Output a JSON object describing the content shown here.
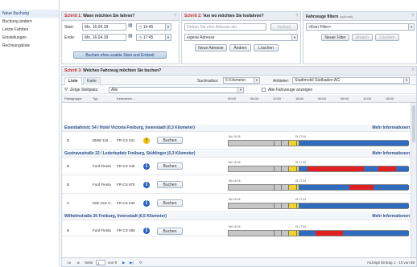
{
  "sidebar": {
    "items": [
      {
        "label": "Neue Buchung"
      },
      {
        "label": "Buchung ändern"
      },
      {
        "label": "Letzte Fahrten"
      },
      {
        "label": "Einstellungen"
      },
      {
        "label": "Rechnungsliste"
      }
    ]
  },
  "step1": {
    "step": "Schritt 1:",
    "title": "Wann möchten Sie fahren?",
    "help": "?",
    "start_label": "Start:",
    "start_date": "Mo. 16.04.18",
    "start_time": "14:45",
    "end_label": "Ende:",
    "end_date": "Mo. 16.04.18",
    "end_time": "17:45",
    "button": "Buchen ohne exakte Start und Endzeit"
  },
  "step2": {
    "step": "Schritt 2:",
    "title": "Von wo möchten Sie losfahren?",
    "help": "?",
    "address_placeholder": "Geben Sie eine Adresse ein",
    "search_btn": "Suchen",
    "address_select": "eigene Adresse",
    "btn_new": "Neue Adresse",
    "btn_change": "Ändern",
    "btn_delete": "Löschen"
  },
  "filter": {
    "title": "Fahrzeuge filtern",
    "optional": "(optional)",
    "help": "?",
    "select": "<Kein Filter>",
    "btn_new": "Neuer Filter",
    "btn_change": "Ändern",
    "btn_delete": "Löschen"
  },
  "step3": {
    "step": "Schritt 3:",
    "title": "Welches Fahrzeug möchten Sie buchen?",
    "help": "?",
    "tabs": [
      "Liste",
      "Karte"
    ],
    "radius_label": "Suchradius:",
    "radius_value": "5 Kilometer",
    "provider_label": "Anbieter:",
    "provider_value": "Stadtmobil Südbaden AG",
    "show_label": "Zeige Stellplatz:",
    "show_value": "Alle",
    "all_vehicles": "Alle Fahrzeuge anzeigen",
    "columns": [
      "Preisgruppe",
      "Typ",
      "Kennzeich..."
    ],
    "hours": [
      "00:00",
      "06:00",
      "12:00",
      "18:00",
      "00:00",
      "06:00",
      "12:00",
      "18:00"
    ],
    "more_info": "Mehr Informationen",
    "book": "Buchen",
    "groups": [
      {
        "name": "Eisenbahnstr. 54 / Hotel Victoria Freiburg, Innenstadt (0,3 Kilometer)",
        "cars": [
          {
            "group": "D",
            "type": "BMW 118 ...",
            "plate": "FR-CS 341",
            "icon": "warning",
            "day1": "Mo 16.04",
            "day2": "Di 17.04"
          }
        ]
      },
      {
        "name": "Gustravestraße 22 / Lederlepfatz Freiburg, Stühlinger (0,3 Kilometer)",
        "cars": [
          {
            "group": "B",
            "type": "Ford Fiesta",
            "plate": "FR-CS 246",
            "icon": "info",
            "day1": "Mo 16.04",
            "day2": "Di 17.04"
          },
          {
            "group": "B",
            "type": "Ford Fiesta",
            "plate": "FR-CS 975",
            "icon": "info",
            "day1": "Mo 16.04",
            "day2": "Di 17.04"
          },
          {
            "group": "C",
            "type": "Mini One 5...",
            "plate": "FR-CS 530",
            "icon": "info",
            "day1": "Mo 16.04",
            "day2": "Di 17.04"
          }
        ]
      },
      {
        "name": "Wilhelmstraße 26 Freiburg, Innenstadt (0,5 Kilometer)",
        "cars": [
          {
            "group": "B",
            "type": "Ford Fiesta",
            "plate": "FR-CS 485",
            "icon": "info",
            "day1": "Mo 16.04",
            "day2": "Di 17.04"
          }
        ]
      }
    ],
    "pager": {
      "page_label": "Seite",
      "page": "1",
      "of": "von 9",
      "summary": "Anzeige Eintrag 1 - 10 von 88"
    }
  },
  "colors": {
    "available": "#2f6bbf",
    "booked": "#e02020",
    "selection": "#f2d22e",
    "past": "#c7c7c7"
  }
}
